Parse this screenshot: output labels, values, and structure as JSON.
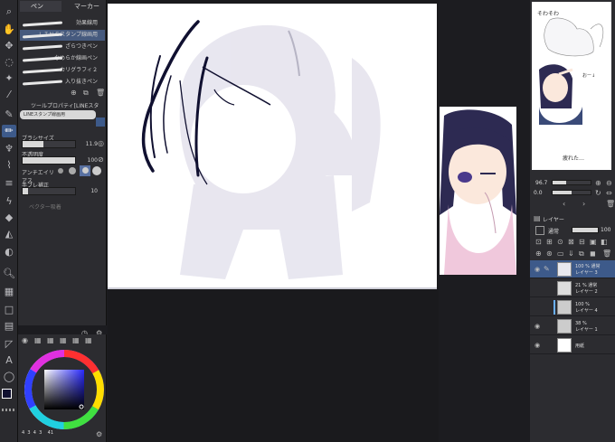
{
  "brush_panel": {
    "tab_pen": "ペン",
    "tab_marker": "マーカー",
    "items": [
      {
        "label": "効果線用"
      },
      {
        "label": "ＬＩＮＥスタンプ線画用",
        "selected": true
      },
      {
        "label": "ざらつきペン"
      },
      {
        "label": "なめらか線画ペン"
      },
      {
        "label": "カリグラフィ２"
      },
      {
        "label": "入り抜きペン"
      }
    ]
  },
  "tool_property": {
    "title": "ツールプロパティ[LINEスタ",
    "subtitle": "LINEスタンプ線画用",
    "brush_size_label": "ブラシサイズ",
    "brush_size_value": "11.9",
    "opacity_label": "不透明度",
    "opacity_value": "100",
    "antialias_label": "アンチエイリアス",
    "stabilization_label": "手ブレ補正",
    "stabilization_value": "10",
    "vector_label": "ベクター吸着"
  },
  "color_panel": {
    "main_color": "#101030",
    "sub_color": "#ffffff",
    "values": [
      "4",
      "3",
      "4",
      "3",
      "41"
    ]
  },
  "navigator": {
    "zoom": "96.7",
    "angle": "0.0",
    "nav_text_top": "そわそわ",
    "nav_text_mid": "おー↓",
    "nav_text_bottom": "疲れた…"
  },
  "layer_panel": {
    "title": "レイヤー",
    "blend_mode": "通常",
    "opacity": "100",
    "layers": [
      {
        "pct": "100 %",
        "mode": "通常",
        "name": "レイヤー 3",
        "selected": true
      },
      {
        "pct": "21 %",
        "mode": "通常",
        "name": "レイヤー 2"
      },
      {
        "pct": "100 %",
        "mode": "",
        "name": "レイヤー 4"
      },
      {
        "pct": "38 %",
        "mode": "",
        "name": "レイヤー 1"
      },
      {
        "pct": "",
        "mode": "",
        "name": "用紙"
      }
    ]
  }
}
